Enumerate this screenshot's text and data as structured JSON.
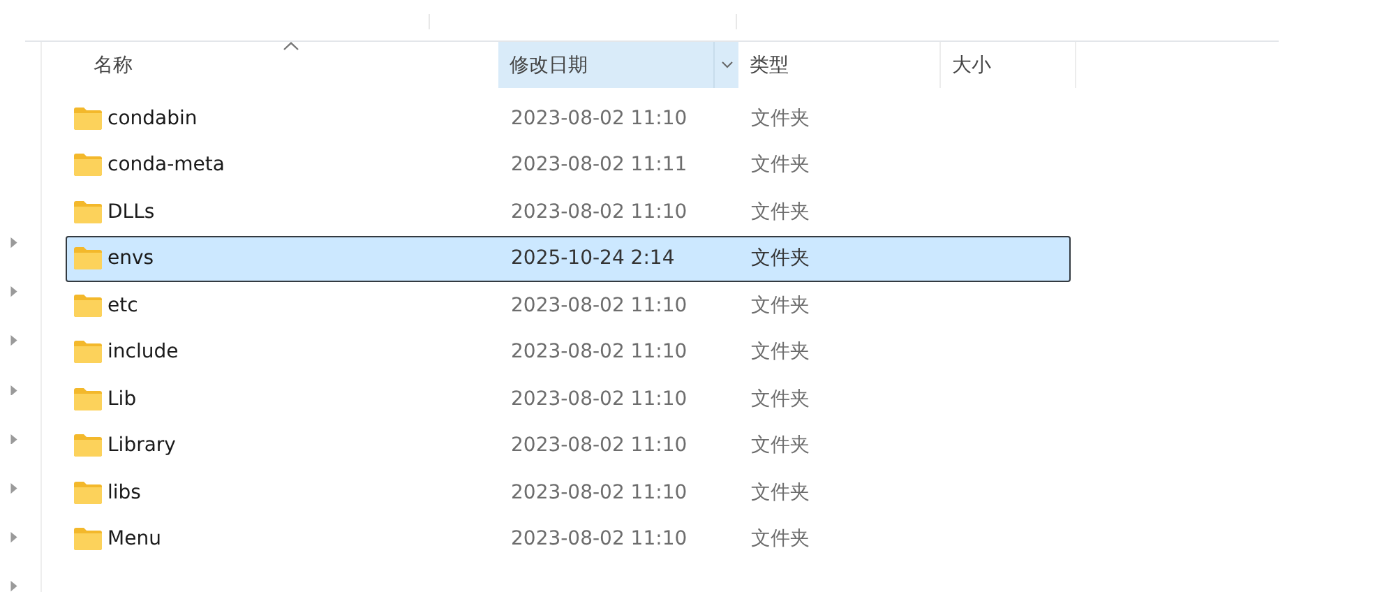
{
  "columns": [
    {
      "label": "名称",
      "kind": "name",
      "sorted_ascending": true,
      "selected": false
    },
    {
      "label": "修改日期",
      "kind": "date",
      "selected": true
    },
    {
      "label": "类型",
      "kind": "type",
      "selected": false
    },
    {
      "label": "大小",
      "kind": "size",
      "selected": false
    }
  ],
  "rows": [
    {
      "name": "condabin",
      "modified": "2023-08-02 11:10",
      "type": "文件夹",
      "selected": false
    },
    {
      "name": "conda-meta",
      "modified": "2023-08-02 11:11",
      "type": "文件夹",
      "selected": false
    },
    {
      "name": "DLLs",
      "modified": "2023-08-02 11:10",
      "type": "文件夹",
      "selected": false
    },
    {
      "name": "envs",
      "modified": "2025-10-24 2:14",
      "type": "文件夹",
      "selected": true
    },
    {
      "name": "etc",
      "modified": "2023-08-02 11:10",
      "type": "文件夹",
      "selected": false
    },
    {
      "name": "include",
      "modified": "2023-08-02 11:10",
      "type": "文件夹",
      "selected": false
    },
    {
      "name": "Lib",
      "modified": "2023-08-02 11:10",
      "type": "文件夹",
      "selected": false
    },
    {
      "name": "Library",
      "modified": "2023-08-02 11:10",
      "type": "文件夹",
      "selected": false
    },
    {
      "name": "libs",
      "modified": "2023-08-02 11:10",
      "type": "文件夹",
      "selected": false
    },
    {
      "name": "Menu",
      "modified": "2023-08-02 11:10",
      "type": "文件夹",
      "selected": false
    }
  ]
}
